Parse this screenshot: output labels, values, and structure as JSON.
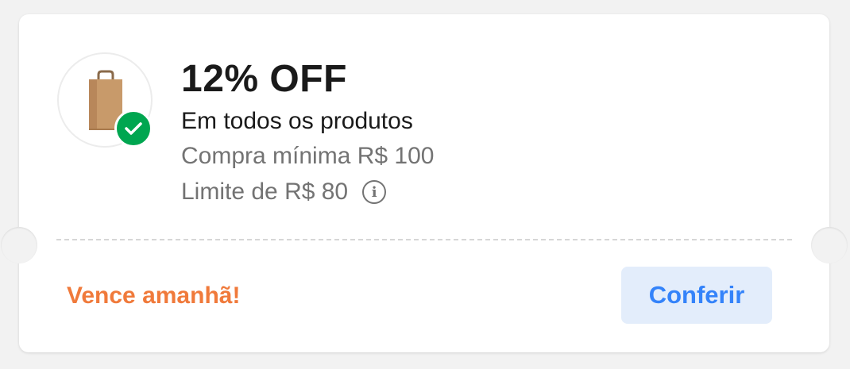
{
  "coupon": {
    "title": "12% OFF",
    "scope": "Em todos os produtos",
    "min_purchase": "Compra mínima R$ 100",
    "limit": "Limite de R$ 80",
    "info_glyph": "i",
    "expiry": "Vence amanhã!",
    "cta_label": "Conferir",
    "image_icon": "shopping-bag",
    "badge_icon": "check-icon"
  },
  "colors": {
    "page_background": "#f2f2f2",
    "card_background": "#ffffff",
    "title": "#1a1a1a",
    "secondary_text": "#737373",
    "badge": "#00a650",
    "expiry": "#f07a3b",
    "cta_text": "#3483fa",
    "cta_background": "#e3edfb"
  }
}
